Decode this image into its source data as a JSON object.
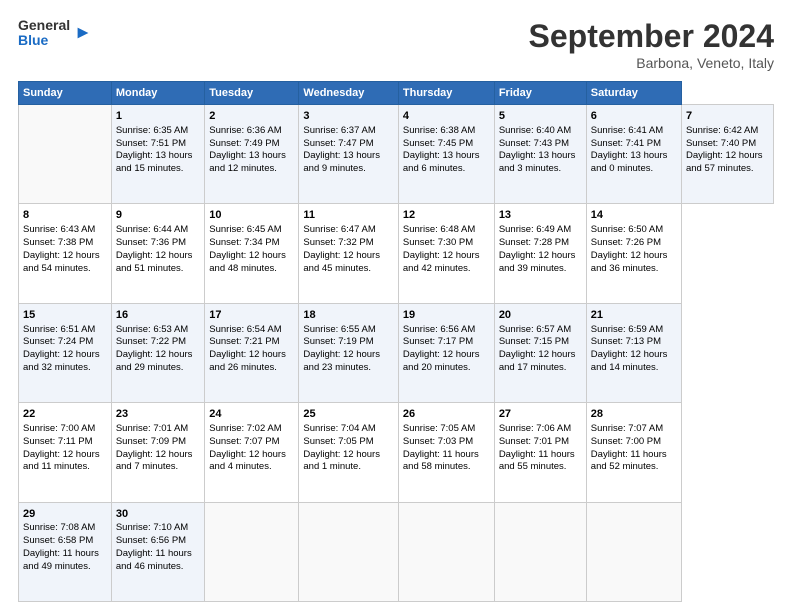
{
  "header": {
    "logo_general": "General",
    "logo_blue": "Blue",
    "month_title": "September 2024",
    "location": "Barbona, Veneto, Italy"
  },
  "calendar": {
    "days_of_week": [
      "Sunday",
      "Monday",
      "Tuesday",
      "Wednesday",
      "Thursday",
      "Friday",
      "Saturday"
    ],
    "weeks": [
      [
        null,
        {
          "day": 1,
          "sunrise": "6:35 AM",
          "sunset": "7:51 PM",
          "daylight": "13 hours and 15 minutes."
        },
        {
          "day": 2,
          "sunrise": "6:36 AM",
          "sunset": "7:49 PM",
          "daylight": "13 hours and 12 minutes."
        },
        {
          "day": 3,
          "sunrise": "6:37 AM",
          "sunset": "7:47 PM",
          "daylight": "13 hours and 9 minutes."
        },
        {
          "day": 4,
          "sunrise": "6:38 AM",
          "sunset": "7:45 PM",
          "daylight": "13 hours and 6 minutes."
        },
        {
          "day": 5,
          "sunrise": "6:40 AM",
          "sunset": "7:43 PM",
          "daylight": "13 hours and 3 minutes."
        },
        {
          "day": 6,
          "sunrise": "6:41 AM",
          "sunset": "7:41 PM",
          "daylight": "13 hours and 0 minutes."
        },
        {
          "day": 7,
          "sunrise": "6:42 AM",
          "sunset": "7:40 PM",
          "daylight": "12 hours and 57 minutes."
        }
      ],
      [
        {
          "day": 8,
          "sunrise": "6:43 AM",
          "sunset": "7:38 PM",
          "daylight": "12 hours and 54 minutes."
        },
        {
          "day": 9,
          "sunrise": "6:44 AM",
          "sunset": "7:36 PM",
          "daylight": "12 hours and 51 minutes."
        },
        {
          "day": 10,
          "sunrise": "6:45 AM",
          "sunset": "7:34 PM",
          "daylight": "12 hours and 48 minutes."
        },
        {
          "day": 11,
          "sunrise": "6:47 AM",
          "sunset": "7:32 PM",
          "daylight": "12 hours and 45 minutes."
        },
        {
          "day": 12,
          "sunrise": "6:48 AM",
          "sunset": "7:30 PM",
          "daylight": "12 hours and 42 minutes."
        },
        {
          "day": 13,
          "sunrise": "6:49 AM",
          "sunset": "7:28 PM",
          "daylight": "12 hours and 39 minutes."
        },
        {
          "day": 14,
          "sunrise": "6:50 AM",
          "sunset": "7:26 PM",
          "daylight": "12 hours and 36 minutes."
        }
      ],
      [
        {
          "day": 15,
          "sunrise": "6:51 AM",
          "sunset": "7:24 PM",
          "daylight": "12 hours and 32 minutes."
        },
        {
          "day": 16,
          "sunrise": "6:53 AM",
          "sunset": "7:22 PM",
          "daylight": "12 hours and 29 minutes."
        },
        {
          "day": 17,
          "sunrise": "6:54 AM",
          "sunset": "7:21 PM",
          "daylight": "12 hours and 26 minutes."
        },
        {
          "day": 18,
          "sunrise": "6:55 AM",
          "sunset": "7:19 PM",
          "daylight": "12 hours and 23 minutes."
        },
        {
          "day": 19,
          "sunrise": "6:56 AM",
          "sunset": "7:17 PM",
          "daylight": "12 hours and 20 minutes."
        },
        {
          "day": 20,
          "sunrise": "6:57 AM",
          "sunset": "7:15 PM",
          "daylight": "12 hours and 17 minutes."
        },
        {
          "day": 21,
          "sunrise": "6:59 AM",
          "sunset": "7:13 PM",
          "daylight": "12 hours and 14 minutes."
        }
      ],
      [
        {
          "day": 22,
          "sunrise": "7:00 AM",
          "sunset": "7:11 PM",
          "daylight": "12 hours and 11 minutes."
        },
        {
          "day": 23,
          "sunrise": "7:01 AM",
          "sunset": "7:09 PM",
          "daylight": "12 hours and 7 minutes."
        },
        {
          "day": 24,
          "sunrise": "7:02 AM",
          "sunset": "7:07 PM",
          "daylight": "12 hours and 4 minutes."
        },
        {
          "day": 25,
          "sunrise": "7:04 AM",
          "sunset": "7:05 PM",
          "daylight": "12 hours and 1 minute."
        },
        {
          "day": 26,
          "sunrise": "7:05 AM",
          "sunset": "7:03 PM",
          "daylight": "11 hours and 58 minutes."
        },
        {
          "day": 27,
          "sunrise": "7:06 AM",
          "sunset": "7:01 PM",
          "daylight": "11 hours and 55 minutes."
        },
        {
          "day": 28,
          "sunrise": "7:07 AM",
          "sunset": "7:00 PM",
          "daylight": "11 hours and 52 minutes."
        }
      ],
      [
        {
          "day": 29,
          "sunrise": "7:08 AM",
          "sunset": "6:58 PM",
          "daylight": "11 hours and 49 minutes."
        },
        {
          "day": 30,
          "sunrise": "7:10 AM",
          "sunset": "6:56 PM",
          "daylight": "11 hours and 46 minutes."
        },
        null,
        null,
        null,
        null,
        null
      ]
    ]
  }
}
